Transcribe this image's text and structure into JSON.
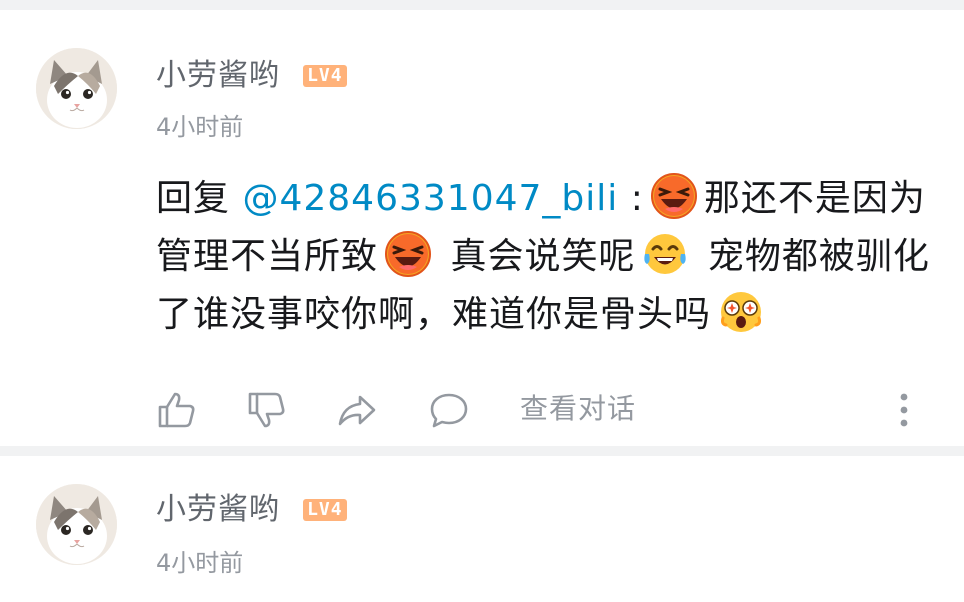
{
  "comments": [
    {
      "username": "小劳酱哟",
      "level": "LV4",
      "time": "4小时前",
      "reply_prefix": "回复 ",
      "mention": "@42846331047_bili",
      "colon": " :",
      "segments": [
        "那还不是因为管理不当所致",
        " 真会说笑呢",
        " 宠物都被驯化了谁没事咬你啊，难道你是骨头吗"
      ],
      "emojis": [
        "laughing-face-emoji",
        "laughing-face-emoji",
        "tears-of-joy-emoji",
        "star-struck-emoji"
      ],
      "actions": {
        "like_icon": "thumbs-up-icon",
        "dislike_icon": "thumbs-down-icon",
        "share_icon": "share-arrow-icon",
        "reply_icon": "speech-bubble-icon",
        "view_conversation": "查看对话",
        "more_icon": "vertical-dots-icon"
      }
    },
    {
      "username": "小劳酱哟",
      "level": "LV4",
      "time": "4小时前"
    }
  ],
  "colors": {
    "mention": "#008ac5",
    "level_badge": "#ffb27a",
    "secondary_text": "#9499a0",
    "username": "#61666d",
    "divider": "#f1f2f3"
  }
}
